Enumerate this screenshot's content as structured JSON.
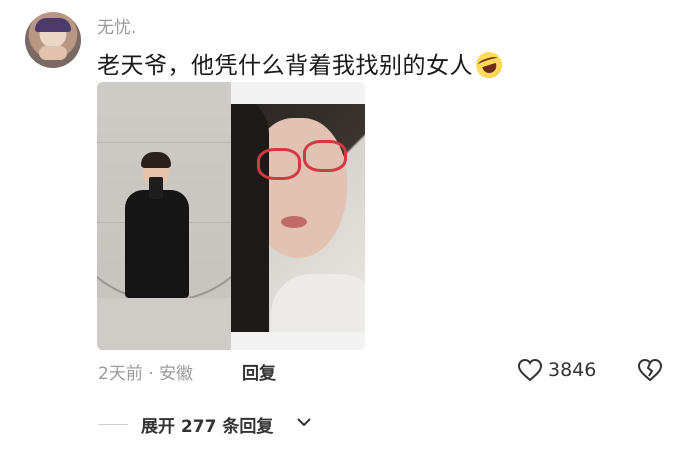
{
  "comment": {
    "username": "无忧.",
    "text": "老天爷，他凭什么背着我找别的女人",
    "emoji_icon": "rolling-on-floor-laughing-emoji",
    "images": [
      {
        "name": "mirror-selfie-photo"
      },
      {
        "name": "red-glasses-portrait-photo"
      }
    ],
    "time_location": "2天前 · 安徽",
    "reply_label": "回复",
    "likes": "3846",
    "icons": {
      "like": "heart-outline-icon",
      "dislike": "broken-heart-icon",
      "expand": "chevron-down-icon"
    }
  },
  "replies": {
    "expand_label": "展开 277 条回复"
  },
  "colors": {
    "secondary_text": "#9a9a9a",
    "primary_text": "#1a1a1a"
  }
}
